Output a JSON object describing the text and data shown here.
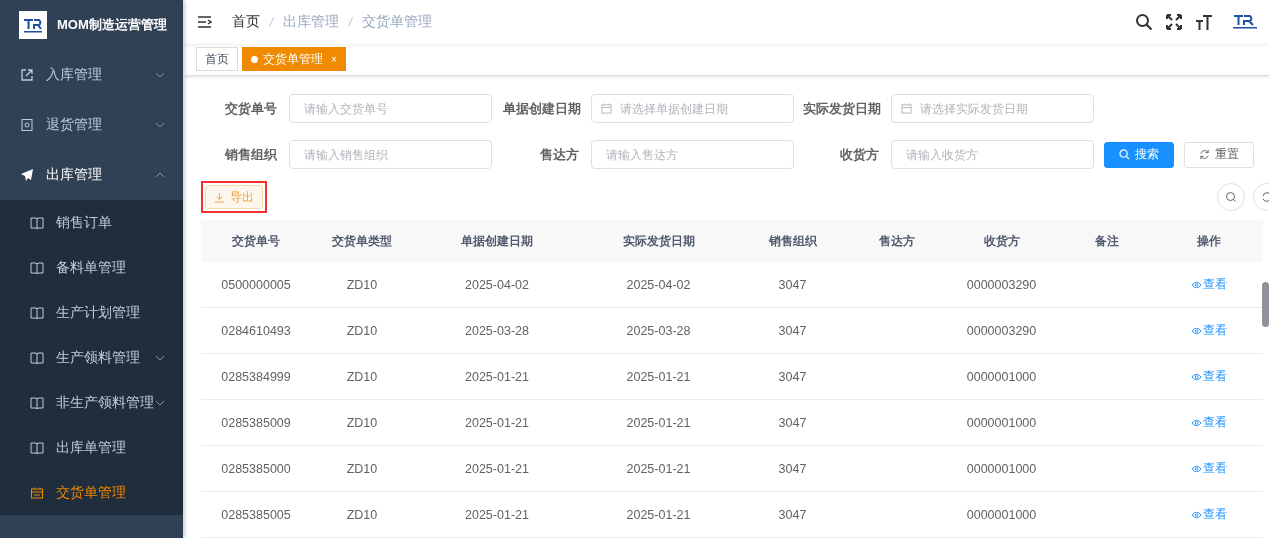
{
  "sidebar": {
    "title": "MOM制造运营管理",
    "items": [
      {
        "label": "入库管理",
        "expanded": false
      },
      {
        "label": "退货管理",
        "expanded": false
      },
      {
        "label": "出库管理",
        "expanded": true,
        "children": [
          {
            "label": "销售订单",
            "expandable": false,
            "selected": false
          },
          {
            "label": "备料单管理",
            "expandable": false,
            "selected": false
          },
          {
            "label": "生产计划管理",
            "expandable": false,
            "selected": false
          },
          {
            "label": "生产领料管理",
            "expandable": true,
            "selected": false
          },
          {
            "label": "非生产领料管理",
            "expandable": true,
            "selected": false
          },
          {
            "label": "出库单管理",
            "expandable": false,
            "selected": false
          },
          {
            "label": "交货单管理",
            "expandable": false,
            "selected": true
          }
        ]
      }
    ]
  },
  "breadcrumb": [
    "首页",
    "出库管理",
    "交货单管理"
  ],
  "tabs": [
    {
      "label": "首页",
      "selected": false
    },
    {
      "label": "交货单管理",
      "selected": true,
      "close": "×"
    }
  ],
  "filters": [
    {
      "label": "交货单号",
      "kind": "text",
      "placeholder": "请输入交货单号"
    },
    {
      "label": "单据创建日期",
      "kind": "date",
      "placeholder": "请选择单据创建日期"
    },
    {
      "label": "实际发货日期",
      "kind": "date",
      "placeholder": "请选择实际发货日期"
    },
    {
      "label": "销售组织",
      "kind": "text",
      "placeholder": "请输入销售组织"
    },
    {
      "label": "售达方",
      "kind": "text",
      "placeholder": "请输入售达方"
    },
    {
      "label": "收货方",
      "kind": "text",
      "placeholder": "请输入收货方"
    }
  ],
  "search_button": "搜索",
  "reset_button": "重置",
  "export_button": {
    "label": "导出",
    "highlighted": true
  },
  "table": {
    "columns": [
      "交货单号",
      "交货单类型",
      "单据创建日期",
      "实际发货日期",
      "销售组织",
      "售达方",
      "收货方",
      "备注",
      "操作"
    ],
    "rows": [
      [
        "0500000005",
        "ZD10",
        "2025-04-02",
        "2025-04-02",
        "3047",
        "",
        "0000003290",
        "",
        "查看"
      ],
      [
        "0284610493",
        "ZD10",
        "2025-03-28",
        "2025-03-28",
        "3047",
        "",
        "0000003290",
        "",
        "查看"
      ],
      [
        "0285384999",
        "ZD10",
        "2025-01-21",
        "2025-01-21",
        "3047",
        "",
        "0000001000",
        "",
        "查看"
      ],
      [
        "0285385009",
        "ZD10",
        "2025-01-21",
        "2025-01-21",
        "3047",
        "",
        "0000001000",
        "",
        "查看"
      ],
      [
        "0285385000",
        "ZD10",
        "2025-01-21",
        "2025-01-21",
        "3047",
        "",
        "0000001000",
        "",
        "查看"
      ],
      [
        "0285385005",
        "ZD10",
        "2025-01-21",
        "2025-01-21",
        "3047",
        "",
        "0000001000",
        "",
        "查看"
      ]
    ]
  }
}
